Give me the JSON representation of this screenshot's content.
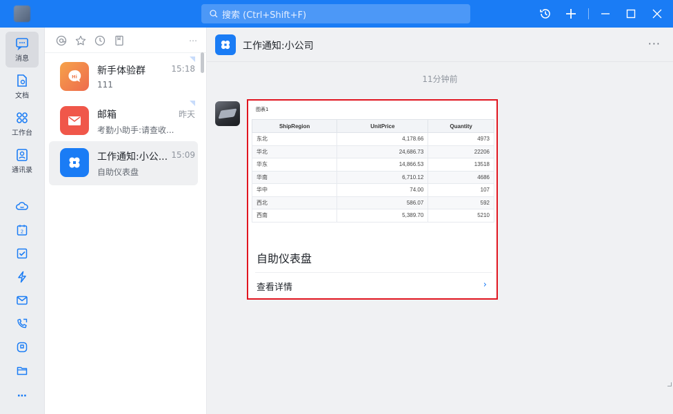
{
  "titlebar": {
    "search_placeholder": "搜索 (Ctrl+Shift+F)"
  },
  "rail": {
    "items": [
      {
        "label": "消息",
        "icon": "message-icon"
      },
      {
        "label": "文档",
        "icon": "document-icon"
      },
      {
        "label": "工作台",
        "icon": "workbench-icon"
      },
      {
        "label": "通讯录",
        "icon": "contacts-icon"
      }
    ],
    "more": "⋯"
  },
  "list": {
    "toolbar_more": "⋯",
    "conversations": [
      {
        "name": "新手体验群",
        "time": "15:18",
        "preview": "111",
        "color": "#f28a4b",
        "icon": "group-chat-icon"
      },
      {
        "name": "邮箱",
        "time": "昨天",
        "preview": "考勤小助手:请查收...",
        "color": "#f0574a",
        "icon": "mail-icon"
      },
      {
        "name": "工作通知:小公...",
        "time": "15:09",
        "preview": "自助仪表盘",
        "color": "#1a7cf5",
        "icon": "work-notice-icon"
      }
    ]
  },
  "chat": {
    "title": "工作通知:小公司",
    "more": "···",
    "timestamp": "11分钟前",
    "card": {
      "caption": "图表1",
      "columns": [
        "ShipRegion",
        "UnitPrice",
        "Quantity"
      ],
      "rows": [
        [
          "东北",
          "4,178.66",
          "4973"
        ],
        [
          "华北",
          "24,686.73",
          "22206"
        ],
        [
          "华东",
          "14,866.53",
          "13518"
        ],
        [
          "华南",
          "6,710.12",
          "4686"
        ],
        [
          "华中",
          "74.00",
          "107"
        ],
        [
          "西北",
          "586.07",
          "592"
        ],
        [
          "西南",
          "5,389.70",
          "5210"
        ]
      ],
      "title": "自助仪表盘",
      "detail_label": "查看详情",
      "chevron": "›"
    }
  }
}
